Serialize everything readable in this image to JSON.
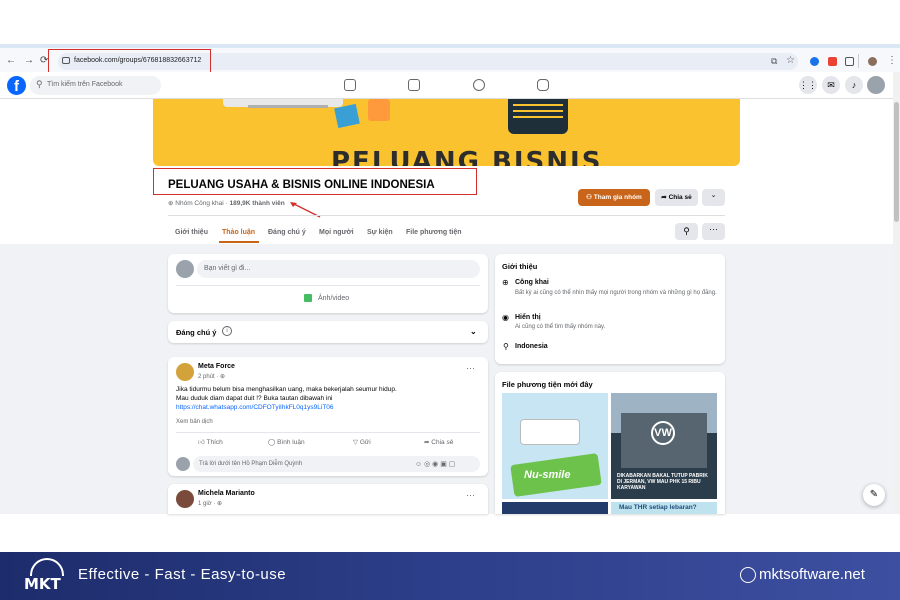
{
  "browser": {
    "url": "facebook.com/groups/676818832663712"
  },
  "fb": {
    "logo": "f",
    "search_placeholder": "Tìm kiếm trên Facebook"
  },
  "banner": {
    "text": "PELUANG BISNIS"
  },
  "group": {
    "name": "PELUANG USAHA & BISNIS ONLINE INDONESIA",
    "meta_prefix": "Nhóm Công khai · ",
    "members": "189,9K thành viên",
    "join_label": "Tham gia nhóm",
    "share_label": "Chia sẻ",
    "more_label": "⌄"
  },
  "tabs": [
    "Giới thiệu",
    "Thảo luận",
    "Đáng chú ý",
    "Mọi người",
    "Sự kiện",
    "File phương tiện"
  ],
  "composer": {
    "placeholder": "Bạn viết gì đi...",
    "photo_label": "Ảnh/video"
  },
  "featured": {
    "label": "Đáng chú ý"
  },
  "post1": {
    "author": "Meta Force",
    "time": "2 phút ·",
    "line1": "Jika tidurmu belum bisa menghasilkan uang, maka bekerjalah seumur hidup.",
    "line2": "Mau duduk diam dapat duit !? Buka tautan dibawah ini",
    "link": "https://chat.whatsapp.com/CDFOTyiIhkFL0q1ys9LiT06",
    "see_translation": "Xem bản dịch",
    "like": "Thích",
    "comment": "Bình luận",
    "send": "Gửi",
    "share": "Chia sẻ",
    "reply_placeholder": "Trả lời dưới tên Hồ Phạm Diễm Quỳnh"
  },
  "post2": {
    "author": "Michela Marianto",
    "time": "1 giờ ·"
  },
  "about": {
    "title": "Giới thiệu",
    "public_title": "Công khai",
    "public_desc": "Bất kỳ ai cũng có thể nhìn thấy mọi người trong nhóm và những gì họ đăng.",
    "visible_title": "Hiển thị",
    "visible_desc": "Ai cũng có thể tìm thấy nhóm này.",
    "location": "Indonesia"
  },
  "media": {
    "title": "File phương tiện mới đây",
    "img1_text": "Nu-smile",
    "img2_text": "DIKABARKAN BAKAL TUTUP PABRIK DI JERMAN, VW MAU PHK 15 RIBU KARYAWAN",
    "img4_text": "Mau THR setiap lebaran?"
  },
  "footer": {
    "brand": "MKT",
    "tagline": "Effective - Fast - Easy-to-use",
    "site": "mktsoftware.net"
  },
  "colors": {
    "fb_blue": "#0866ff",
    "join_orange": "#c8651b",
    "banner_yellow": "#f9c22e",
    "active_tab": "#c8651b",
    "highlight_red": "#d32f2f",
    "footer_navy": "#1d2c6b"
  }
}
